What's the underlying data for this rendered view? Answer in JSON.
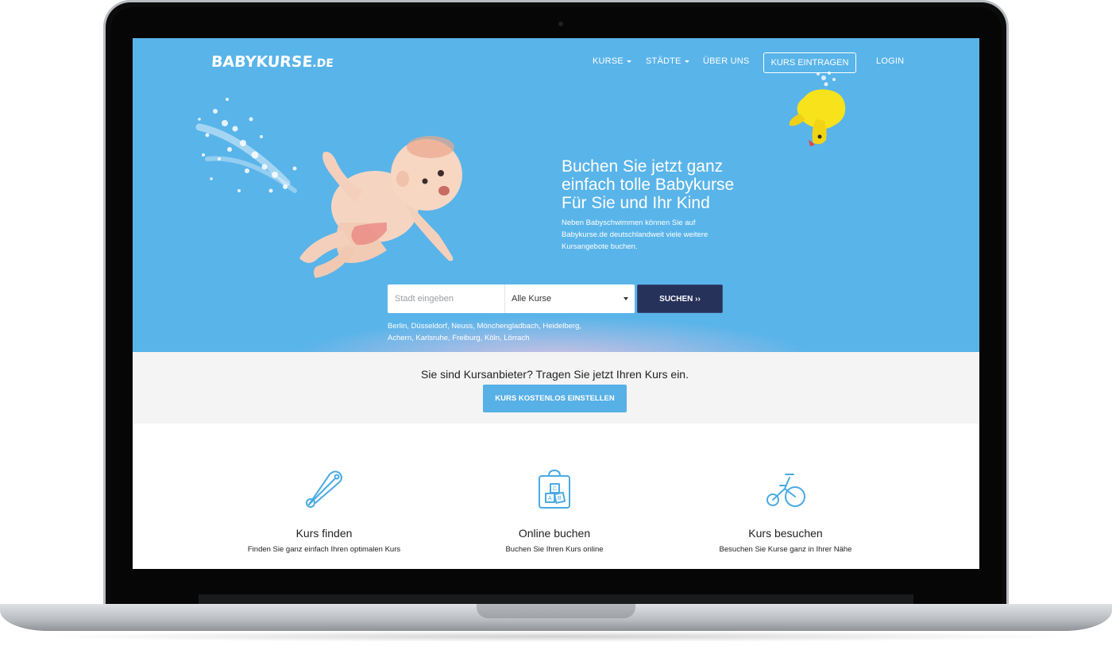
{
  "brand": {
    "logo_main": "BABYKURSE",
    "logo_tld": ".DE",
    "color_sky": "#59b4e9",
    "color_navy": "#27325b",
    "color_button": "#57b0e6"
  },
  "nav": {
    "items": [
      {
        "label": "KURSE",
        "has_caret": true
      },
      {
        "label": "STÄDTE",
        "has_caret": true
      },
      {
        "label": "ÜBER UNS",
        "has_caret": false
      }
    ],
    "cta_label": "KURS EINTRAGEN",
    "login_label": "LOGIN"
  },
  "hero": {
    "headline_lines": [
      "Buchen Sie jetzt ganz",
      "einfach tolle Babykurse",
      "Für Sie und Ihr Kind"
    ],
    "subline_lines": [
      "Neben Babyschwimmen können Sie auf",
      "Babykurse.de deutschlandweit viele weitere",
      "Kursangebote buchen."
    ]
  },
  "search": {
    "city_placeholder": "Stadt eingeben",
    "course_selected": "Alle Kurse",
    "submit_label": "SUCHEN ››",
    "cities_line1": "Berlin, Düsseldorf, Neuss, Mönchengladbach, Heidelberg,",
    "cities_line2": "Achern, Karlsruhe, Freiburg, Köln, Lörrach"
  },
  "provider": {
    "text": "Sie sind Kursanbieter? Tragen Sie jetzt Ihren Kurs ein.",
    "button_label": "KURS KOSTENLOS EINSTELLEN"
  },
  "features": [
    {
      "icon": "safety-pin-icon",
      "title": "Kurs finden",
      "text": "Finden Sie ganz einfach Ihren optimalen Kurs"
    },
    {
      "icon": "blocks-bag-icon",
      "title": "Online buchen",
      "text": "Buchen Sie Ihren Kurs online"
    },
    {
      "icon": "tricycle-icon",
      "title": "Kurs besuchen",
      "text": "Besuchen Sie Kurse ganz in Ihrer Nähe"
    }
  ]
}
